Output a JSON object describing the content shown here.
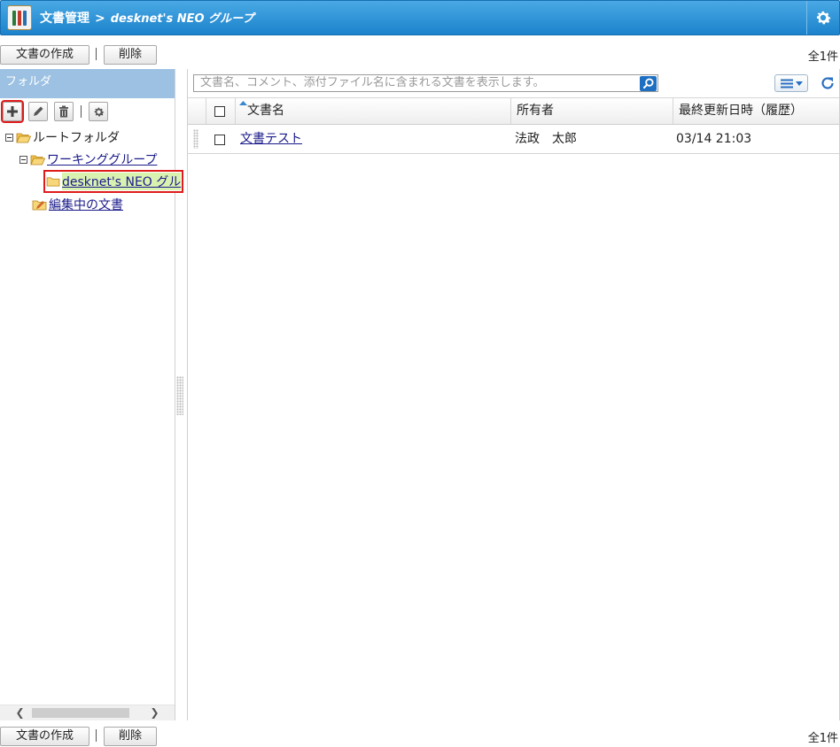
{
  "header": {
    "app_title": "文書管理",
    "separator": ">",
    "current_folder": "desknet's NEO グループ"
  },
  "toolbar": {
    "create_label": "文書の作成",
    "delete_label": "削除",
    "total_count": "全1件"
  },
  "sidebar": {
    "title": "フォルダ",
    "tree": {
      "root": "ルートフォルダ",
      "working_group": "ワーキンググループ",
      "selected_folder": "desknet's NEO グル",
      "editing_docs": "編集中の文書"
    }
  },
  "search": {
    "placeholder": "文書名、コメント、添付ファイル名に含まれる文書を表示します。"
  },
  "table": {
    "columns": [
      "文書名",
      "所有者",
      "最終更新日時（履歴）"
    ],
    "rows": [
      {
        "name": "文書テスト",
        "owner": "法政　太郎",
        "updated": "03/14 21:03"
      }
    ]
  },
  "colors": {
    "titlebar": "#2a8fd6",
    "folder_header": "#9cc1e2",
    "highlight": "#e01b1b",
    "selected_bg": "#d9f2b0",
    "link": "#1a1a8a"
  },
  "icons": {
    "app": "document-manager-icon",
    "settings": "gear-icon",
    "add": "plus-icon",
    "edit": "pencil-icon",
    "trash": "trash-icon",
    "folder_settings": "gear-icon",
    "search": "search-icon",
    "view": "list-view-icon",
    "refresh": "refresh-icon"
  }
}
